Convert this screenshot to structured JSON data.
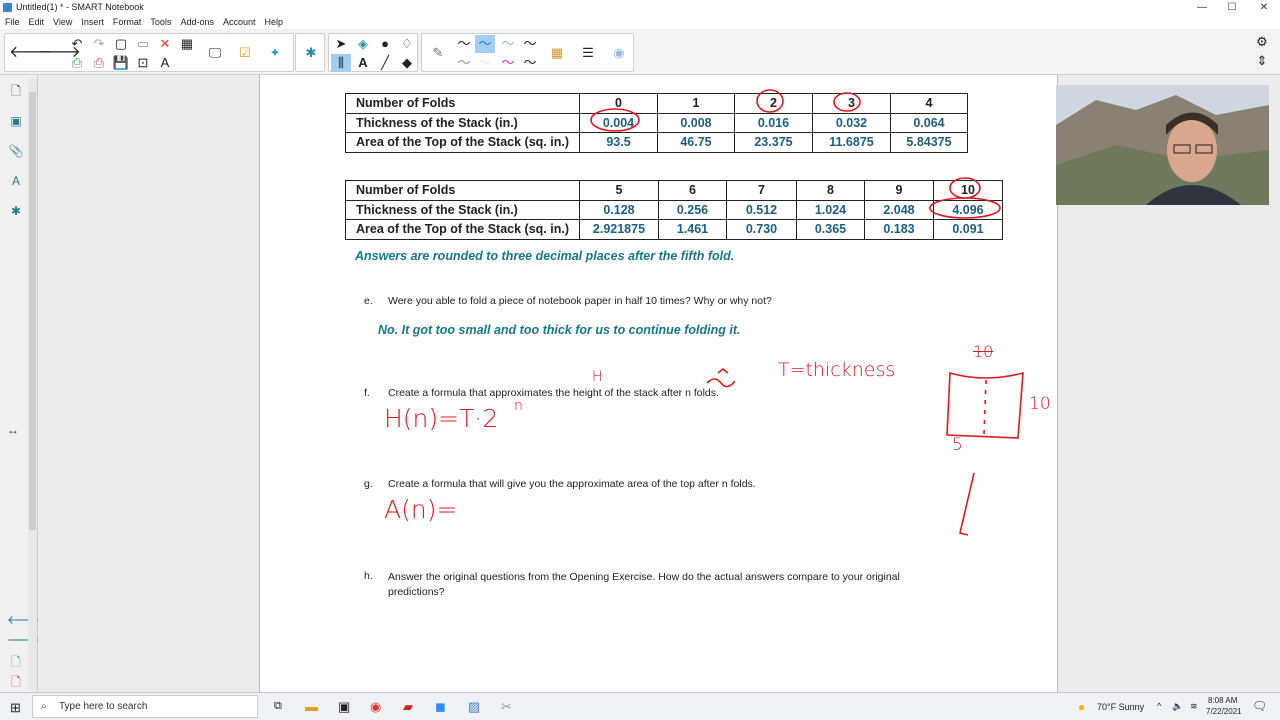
{
  "window": {
    "title": "Untitled(1) * - SMART Notebook",
    "minimize": "—",
    "maximize": "☐",
    "close": "✕"
  },
  "menu": [
    "File",
    "Edit",
    "View",
    "Insert",
    "Format",
    "Tools",
    "Add-ons",
    "Account",
    "Help"
  ],
  "table1": {
    "headers": [
      "Number of Folds",
      "0",
      "1",
      "2",
      "3",
      "4"
    ],
    "thickness": [
      "Thickness of the Stack (in.)",
      "0.004",
      "0.008",
      "0.016",
      "0.032",
      "0.064"
    ],
    "area": [
      "Area of the Top of the Stack (sq. in.)",
      "93.5",
      "46.75",
      "23.375",
      "11.6875",
      "5.84375"
    ]
  },
  "table2": {
    "headers": [
      "Number of Folds",
      "5",
      "6",
      "7",
      "8",
      "9",
      "10"
    ],
    "thickness": [
      "Thickness of the Stack (in.)",
      "0.128",
      "0.256",
      "0.512",
      "1.024",
      "2.048",
      "4.096"
    ],
    "area": [
      "Area of the Top of the Stack (sq. in.)",
      "2.921875",
      "1.461",
      "0.730",
      "0.365",
      "0.183",
      "0.091"
    ]
  },
  "rounding_note": "Answers are rounded to three decimal places after the fifth fold.",
  "questions": {
    "e": {
      "letter": "e.",
      "text": "Were you able to fold a piece of notebook paper in half 10 times?  Why or why not?",
      "answer": "No.  It got too small and too thick for us to continue folding it."
    },
    "f": {
      "letter": "f.",
      "text": "Create a formula that approximates the height of the stack after n folds."
    },
    "g": {
      "letter": "g.",
      "text": "Create a formula that will give you the approximate area of the top after n folds."
    },
    "h": {
      "letter": "h.",
      "text": "Answer the original questions from the Opening Exercise.  How do the actual answers compare to your original predictions?"
    }
  },
  "handwriting": {
    "h_label": "H",
    "t_def": "T=thickness",
    "h_formula": "H(n)=T·2",
    "h_exp": "n",
    "a_formula": "A(n)=",
    "dim_side": "10",
    "dim_bottom": "5",
    "dim_top": "10"
  },
  "ink_color": "#e0191f",
  "taskbar": {
    "search_placeholder": "Type here to search",
    "weather": "70°F  Sunny",
    "time": "8:08 AM",
    "date": "7/22/2021"
  }
}
